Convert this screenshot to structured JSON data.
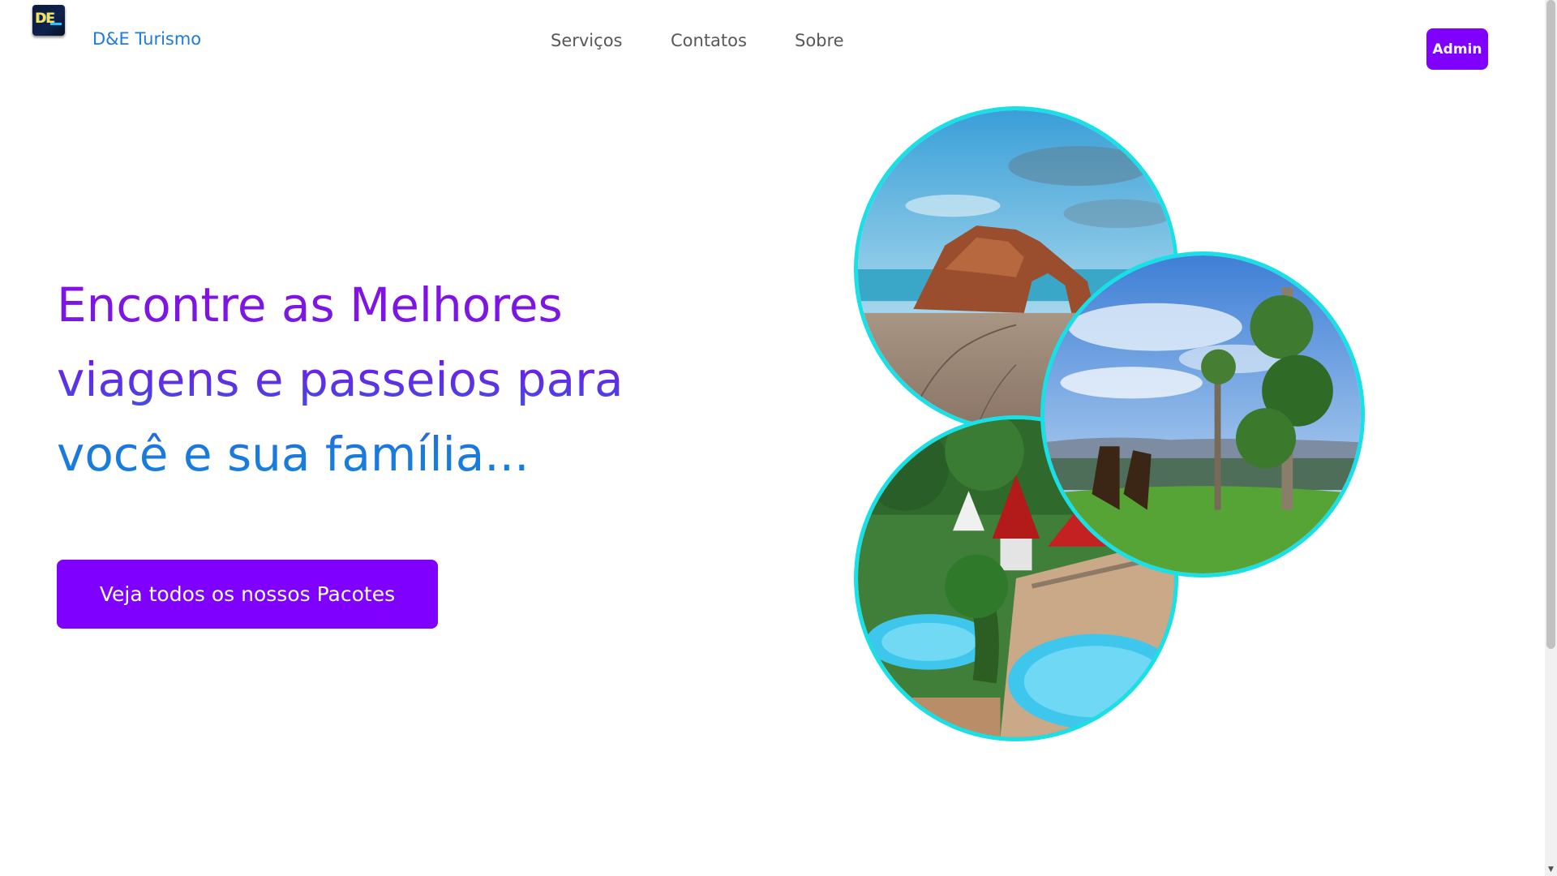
{
  "header": {
    "logo_text": "DE",
    "brand": "D&E Turismo",
    "nav": [
      {
        "label": "Serviços"
      },
      {
        "label": "Contatos"
      },
      {
        "label": "Sobre"
      }
    ],
    "admin_label": "Admin"
  },
  "hero": {
    "title_lines": [
      "Encontre as Melhores",
      "viagens e passeios para",
      "você e sua família..."
    ],
    "cta_label": "Veja todos os nossos Pacotes"
  },
  "gallery": [
    {
      "subject": "rock arch on beach"
    },
    {
      "subject": "mountain lookout with chairs and trees"
    },
    {
      "subject": "water park with pools"
    }
  ],
  "colors": {
    "accent": "#7f00ff",
    "brand_blue": "#1c7be0",
    "circle_border": "#19e0e6"
  }
}
